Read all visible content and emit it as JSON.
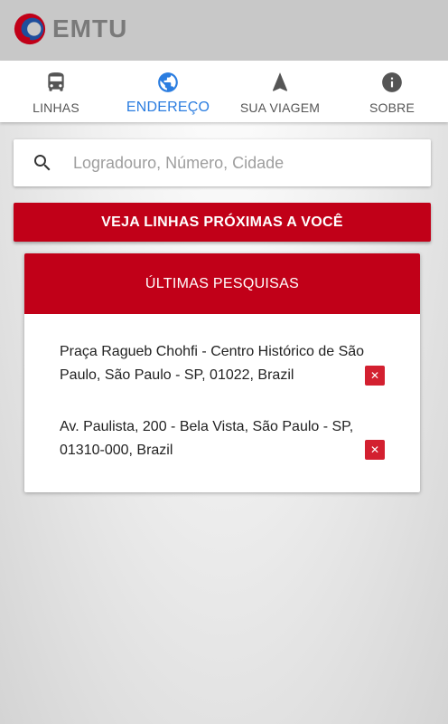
{
  "header": {
    "brand": "EMTU",
    "colors": {
      "brand_red": "#c10018",
      "brand_blue": "#1f4e9c",
      "bar": "#c8c8c8"
    }
  },
  "tabs": [
    {
      "label": "LINHAS",
      "icon": "bus-icon",
      "active": false
    },
    {
      "label": "ENDEREÇO",
      "icon": "globe-icon",
      "active": true
    },
    {
      "label": "SUA VIAGEM",
      "icon": "navigation-arrow-icon",
      "active": false
    },
    {
      "label": "SOBRE",
      "icon": "info-icon",
      "active": false
    }
  ],
  "search": {
    "placeholder": "Logradouro, Número, Cidade",
    "value": ""
  },
  "nearby_button": {
    "label": "VEJA LINHAS PRÓXIMAS A VOCÊ"
  },
  "recent": {
    "title": "ÚLTIMAS PESQUISAS",
    "items": [
      {
        "line1": "Praça Ragueb Chohfi - Centro Histórico de São",
        "line2": "Paulo, São Paulo - SP, 01022, Brazil"
      },
      {
        "line1": "Av. Paulista, 200 - Bela Vista, São Paulo - SP,",
        "line2": "01310-000, Brazil"
      }
    ],
    "delete_glyph": "✕"
  }
}
